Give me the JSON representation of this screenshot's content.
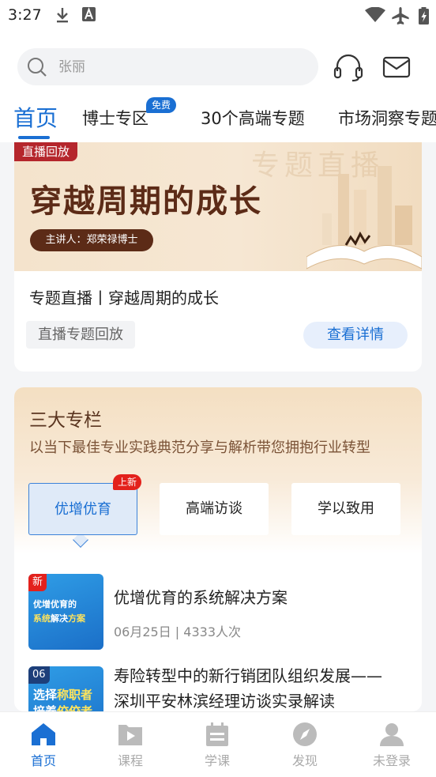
{
  "status_bar": {
    "time": "3:27"
  },
  "search": {
    "placeholder": "张丽"
  },
  "tabs": [
    {
      "label": "首页",
      "active": true
    },
    {
      "label": "博士专区",
      "badge": "免费"
    },
    {
      "label": "30个高端专题"
    },
    {
      "label": "市场洞察专题"
    }
  ],
  "live": {
    "banner_tag": "直播回放",
    "banner_title": "穿越周期的成长",
    "banner_speaker": "主讲人：郑荣禄博士",
    "banner_watermark": "专题直播",
    "title": "专题直播丨穿越周期的成长",
    "tag": "直播专题回放",
    "detail_button": "查看详情"
  },
  "columns": {
    "title": "三大专栏",
    "description": "以当下最佳专业实践典范分享与解析带您拥抱行业转型",
    "segments": [
      {
        "label": "优增优育",
        "active": true,
        "badge": "上新"
      },
      {
        "label": "高端访谈"
      },
      {
        "label": "学以致用"
      }
    ],
    "courses": [
      {
        "thumb_tag": "新",
        "thumb_line1": "优增优育的",
        "thumb_line2a": "系统",
        "thumb_line2b": "解决",
        "thumb_line2c": "方案",
        "title": "优增优育的系统解决方案",
        "meta": "06月25日 | 4333人次"
      },
      {
        "thumb_tag": "06",
        "thumb_line1a": "选择",
        "thumb_line1b": "称职者",
        "thumb_line2a": "培养",
        "thumb_line2b": "佼佼者",
        "title_line1": "寿险转型中的新行销团队组织发展——",
        "title_line2": "深圳平安林滨经理访谈实录解读"
      }
    ]
  },
  "bottom_nav": [
    {
      "label": "首页",
      "icon": "home-icon",
      "active": true
    },
    {
      "label": "课程",
      "icon": "play-icon"
    },
    {
      "label": "学课",
      "icon": "calendar-icon"
    },
    {
      "label": "发现",
      "icon": "compass-icon"
    },
    {
      "label": "未登录",
      "icon": "user-icon"
    }
  ],
  "colors": {
    "accent": "#1a6fd3",
    "badge_red": "#e3211c",
    "banner_brown": "#5c2b17"
  }
}
